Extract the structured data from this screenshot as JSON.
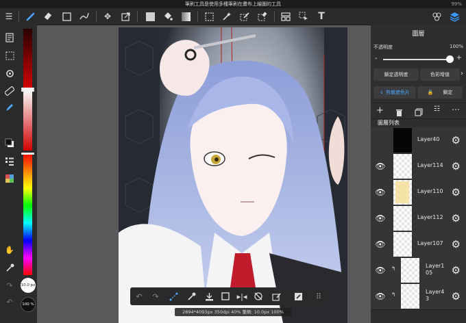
{
  "status": {
    "title": "筆刷工具是使用多種筆刷在畫布上繪圖的工具",
    "battery": "99%"
  },
  "panel": {
    "title": "圖層",
    "opacity_label": "不透明度",
    "opacity_value": "100%",
    "opacity_minus": "-",
    "opacity_plus": "+",
    "lock_alpha": "鎖定透明度",
    "color_adjust": "色彩增值",
    "clip_label": "剪裁遮色片",
    "lock_label": "鎖定",
    "list_title": "圖層列表",
    "layers": [
      {
        "name": "Layer40"
      },
      {
        "name": "Layer114"
      },
      {
        "name": "Layer110"
      },
      {
        "name": "Layer112"
      },
      {
        "name": "Layer107"
      },
      {
        "name": "Layer105"
      },
      {
        "name": "Layer43"
      }
    ]
  },
  "brush": {
    "size_label": "10.0 px",
    "opacity_label": "100 %"
  },
  "info_text": "2894*4093px 350dpi 40% 筆刷: 10.0px 100%",
  "colors": {
    "accent": "#3a9bff",
    "active_tool": "#4aa8ff"
  }
}
